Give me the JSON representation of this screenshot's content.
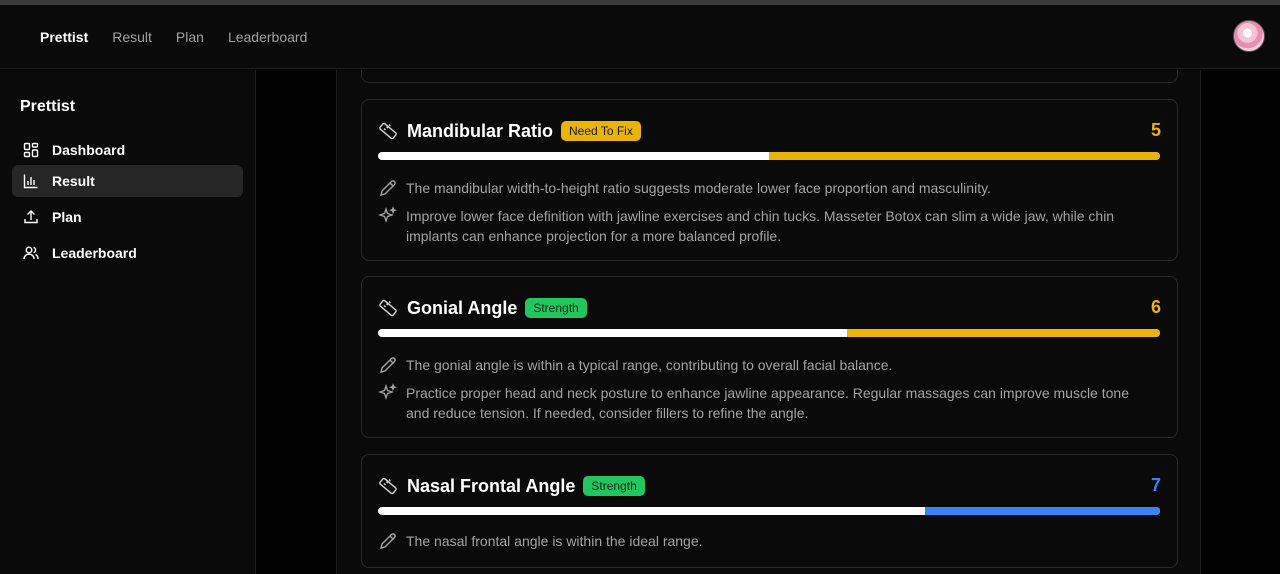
{
  "topnav": {
    "items": [
      {
        "label": "Prettist",
        "active": true
      },
      {
        "label": "Result",
        "active": false
      },
      {
        "label": "Plan",
        "active": false
      },
      {
        "label": "Leaderboard",
        "active": false
      }
    ]
  },
  "sidebar": {
    "brand": "Prettist",
    "items": [
      {
        "label": "Dashboard",
        "icon": "dashboard-icon",
        "active": false
      },
      {
        "label": "Result",
        "icon": "bar-chart-icon",
        "active": true
      },
      {
        "label": "Plan",
        "icon": "upload-icon",
        "active": false
      },
      {
        "label": "Leaderboard",
        "icon": "users-icon",
        "active": false
      }
    ]
  },
  "cards": [
    {
      "title": "Mandibular Ratio",
      "badge": "Need To Fix",
      "badge_type": "fix",
      "score": "5",
      "score_color": "#eab308",
      "progress": 0.5,
      "observation": "The mandibular width-to-height ratio suggests moderate lower face proportion and masculinity.",
      "advice": "Improve lower face definition with jawline exercises and chin tucks. Masseter Botox can slim a wide jaw, while chin implants can enhance projection for a more balanced profile."
    },
    {
      "title": "Gonial Angle",
      "badge": "Strength",
      "badge_type": "strength",
      "score": "6",
      "score_color": "#eab308",
      "progress": 0.6,
      "observation": "The gonial angle is within a typical range, contributing to overall facial balance.",
      "advice": "Practice proper head and neck posture to enhance jawline appearance. Regular massages can improve muscle tone and reduce tension. If needed, consider fillers to refine the angle."
    },
    {
      "title": "Nasal Frontal Angle",
      "badge": "Strength",
      "badge_type": "strength",
      "score": "7",
      "score_color": "#3b82f6",
      "progress": 0.7,
      "observation": "The nasal frontal angle is within the ideal range."
    }
  ],
  "colors": {
    "accent_yellow": "#eab308",
    "accent_blue": "#3b82f6",
    "accent_green": "#22c55e"
  }
}
